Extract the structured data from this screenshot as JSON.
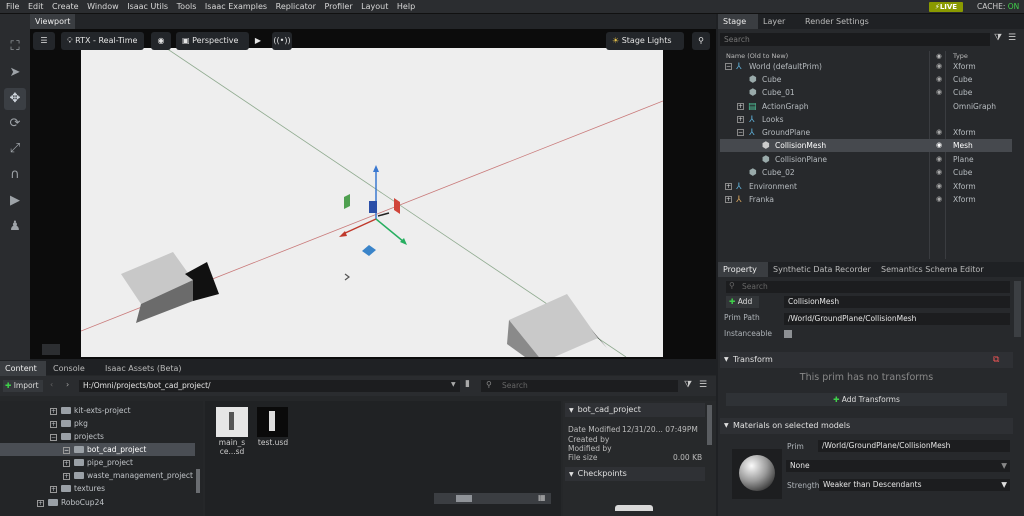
{
  "menu": [
    "File",
    "Edit",
    "Create",
    "Window",
    "Isaac Utils",
    "Tools",
    "Isaac Examples",
    "Replicator",
    "Profiler",
    "Layout",
    "Help"
  ],
  "status": {
    "live_label": "LIVE",
    "cache_label": "CACHE:",
    "cache_value": "ON"
  },
  "viewport": {
    "tab": "Viewport",
    "renderer": "RTX - Real-Time",
    "camera": "Perspective",
    "lights": "Stage Lights"
  },
  "stage": {
    "tabs": [
      "Stage",
      "Layer",
      "Render Settings"
    ],
    "search_placeholder": "Search",
    "col_name": "Name (Old to New)",
    "col_type": "Type",
    "rows": [
      {
        "name": "World (defaultPrim)",
        "type": "Xform"
      },
      {
        "name": "Cube",
        "type": "Cube"
      },
      {
        "name": "Cube_01",
        "type": "Cube"
      },
      {
        "name": "ActionGraph",
        "type": "OmniGraph"
      },
      {
        "name": "Looks",
        "type": ""
      },
      {
        "name": "GroundPlane",
        "type": "Xform"
      },
      {
        "name": "CollisionMesh",
        "type": "Mesh"
      },
      {
        "name": "CollisionPlane",
        "type": "Plane"
      },
      {
        "name": "Cube_02",
        "type": "Cube"
      },
      {
        "name": "Environment",
        "type": "Xform"
      },
      {
        "name": "Franka",
        "type": "Xform"
      }
    ]
  },
  "property": {
    "tabs": [
      "Property",
      "Synthetic Data Recorder",
      "Semantics Schema Editor"
    ],
    "search_placeholder": "Search",
    "add_label": "Add",
    "prim_name": "CollisionMesh",
    "prim_path_label": "Prim Path",
    "prim_path": "/World/GroundPlane/CollisionMesh",
    "instanceable_label": "Instanceable",
    "transform_header": "Transform",
    "no_transforms": "This prim has no transforms",
    "add_transforms": "Add Transforms",
    "materials_header": "Materials on selected models",
    "prim_label": "Prim",
    "prim_value": "/World/GroundPlane/CollisionMesh",
    "material_value": "None",
    "strength_label": "Strength",
    "strength_value": "Weaker than Descendants"
  },
  "content": {
    "tabs": [
      "Content",
      "Console",
      "Isaac Assets (Beta)"
    ],
    "import_label": "Import",
    "path": "H:/Omni/projects/bot_cad_project/",
    "search_placeholder": "Search",
    "tree": [
      {
        "label": "kit-exts-project",
        "indent": 50
      },
      {
        "label": "pkg",
        "indent": 50
      },
      {
        "label": "projects",
        "indent": 50
      },
      {
        "label": "bot_cad_project",
        "indent": 63
      },
      {
        "label": "pipe_project",
        "indent": 63
      },
      {
        "label": "waste_management_project",
        "indent": 63
      },
      {
        "label": "textures",
        "indent": 50
      },
      {
        "label": "RoboCup24",
        "indent": 37
      }
    ],
    "files": [
      {
        "label": "main_s ce...sd"
      },
      {
        "label": "test.usd"
      }
    ],
    "details": {
      "folder": "bot_cad_project",
      "date_label": "Date Modified",
      "date_value": "12/31/20... 07:49PM",
      "created_label": "Created by",
      "modified_label": "Modified by",
      "size_label": "File size",
      "size_value": "0.00 KB",
      "checkpoints": "Checkpoints"
    }
  }
}
